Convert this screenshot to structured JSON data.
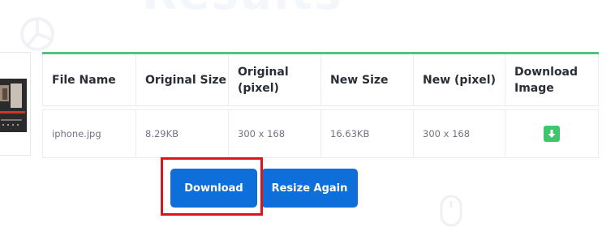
{
  "background": {
    "title": "Results"
  },
  "table": {
    "headers": [
      "File Name",
      "Original Size",
      "Original (pixel)",
      "New Size",
      "New (pixel)",
      "Download Image"
    ],
    "rows": [
      {
        "file_name": "iphone.jpg",
        "original_size": "8.29KB",
        "original_pixel": "300 x 168",
        "new_size": "16.63KB",
        "new_pixel": "300 x 168",
        "download_icon": "download-arrow-icon"
      }
    ]
  },
  "actions": {
    "download_label": "Download",
    "resize_again_label": "Resize Again"
  },
  "colors": {
    "accent": "#0e6fda",
    "table_top_border": "#55c083",
    "download_icon_bg": "#3fc56b",
    "highlight": "#e0121c"
  }
}
